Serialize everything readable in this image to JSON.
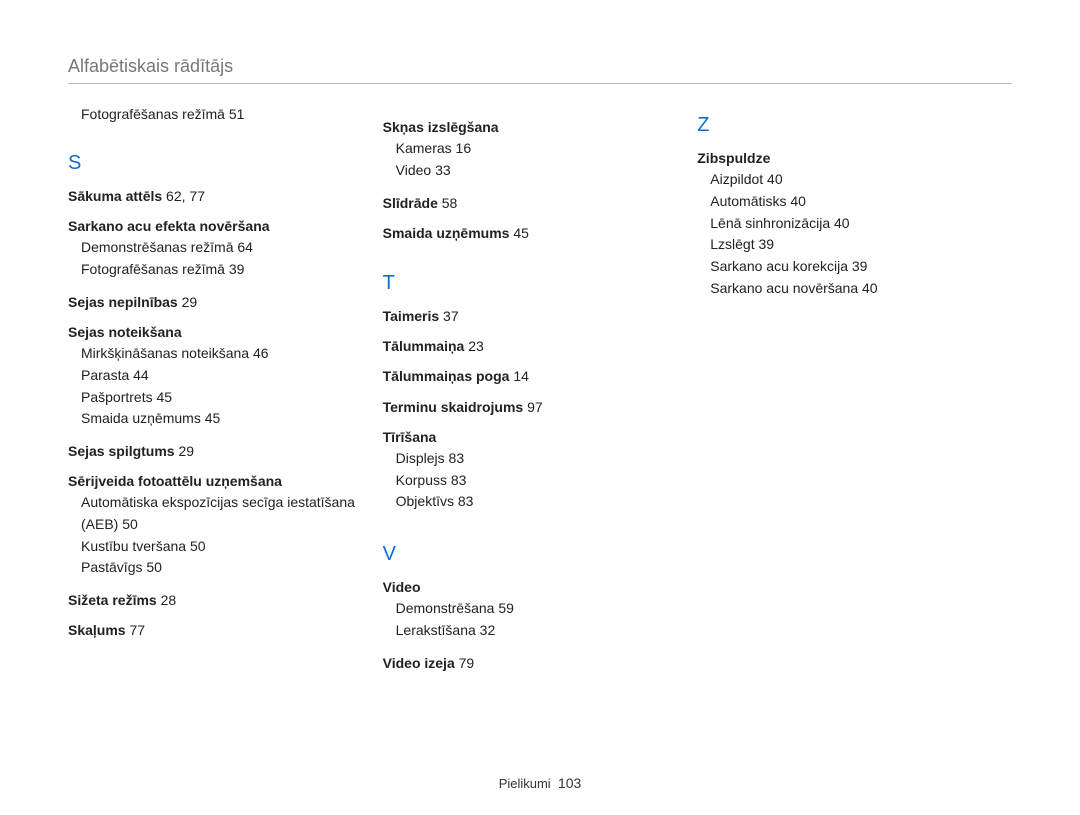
{
  "header": "Alfabētiskais rādītājs",
  "footer": {
    "section": "Pielikumi",
    "page": "103"
  },
  "columns": [
    {
      "preLine": {
        "text": "Fotografēšanas režīmā",
        "page": "51"
      },
      "groups": [
        {
          "letter": "S",
          "entries": [
            {
              "label": "Sākuma attēls",
              "pages": "62, 77"
            },
            {
              "label": "Sarkano acu efekta novēršana",
              "subs": [
                {
                  "text": "Demonstrēšanas režīmā",
                  "page": "64"
                },
                {
                  "text": "Fotografēšanas režīmā",
                  "page": "39"
                }
              ]
            },
            {
              "label": "Sejas nepilnības",
              "pages": "29"
            },
            {
              "label": "Sejas noteikšana",
              "subs": [
                {
                  "text": "Mirkšķināšanas noteikšana",
                  "page": "46"
                },
                {
                  "text": "Parasta",
                  "page": "44"
                },
                {
                  "text": "Pašportrets",
                  "page": "45"
                },
                {
                  "text": "Smaida uzņēmums",
                  "page": "45"
                }
              ]
            },
            {
              "label": "Sejas spilgtums",
              "pages": "29"
            },
            {
              "label": "Sērijveida fotoattēlu uzņemšana",
              "subs": [
                {
                  "text": "Automātiska ekspozīcijas secīga iestatīšana (AEB)",
                  "page": "50"
                },
                {
                  "text": "Kustību tveršana",
                  "page": "50"
                },
                {
                  "text": "Pastāvīgs",
                  "page": "50"
                }
              ]
            },
            {
              "label": "Sižeta režīms",
              "pages": "28"
            },
            {
              "label": "Skaļums",
              "pages": "77"
            }
          ]
        }
      ]
    },
    {
      "groups": [
        {
          "entries": [
            {
              "label": "Skņas izslēgšana",
              "subs": [
                {
                  "text": "Kameras",
                  "page": "16"
                },
                {
                  "text": "Video",
                  "page": "33"
                }
              ]
            },
            {
              "label": "Slīdrāde",
              "pages": "58"
            },
            {
              "label": "Smaida uzņēmums",
              "pages": "45"
            }
          ]
        },
        {
          "letter": "T",
          "entries": [
            {
              "label": "Taimeris",
              "pages": "37"
            },
            {
              "label": "Tālummaiņa",
              "pages": "23"
            },
            {
              "label": "Tālummaiņas poga",
              "pages": "14"
            },
            {
              "label": "Terminu skaidrojums",
              "pages": "97"
            },
            {
              "label": "Tīrīšana",
              "subs": [
                {
                  "text": "Displejs",
                  "page": "83"
                },
                {
                  "text": "Korpuss",
                  "page": "83"
                },
                {
                  "text": "Objektīvs",
                  "page": "83"
                }
              ]
            }
          ]
        },
        {
          "letter": "V",
          "entries": [
            {
              "label": "Video",
              "subs": [
                {
                  "text": "Demonstrēšana",
                  "page": "59"
                },
                {
                  "text": "Lerakstīšana",
                  "page": "32"
                }
              ]
            },
            {
              "label": "Video izeja",
              "pages": "79"
            }
          ]
        }
      ]
    },
    {
      "groups": [
        {
          "letter": "Z",
          "entries": [
            {
              "label": "Zibspuldze",
              "subs": [
                {
                  "text": "Aizpildot",
                  "page": "40"
                },
                {
                  "text": "Automātisks",
                  "page": "40"
                },
                {
                  "text": "Lēnā sinhronizācija",
                  "page": "40"
                },
                {
                  "text": "Lzslēgt",
                  "page": "39"
                },
                {
                  "text": "Sarkano acu korekcija",
                  "page": "39"
                },
                {
                  "text": "Sarkano acu novēršana",
                  "page": "40"
                }
              ]
            }
          ]
        }
      ]
    }
  ]
}
